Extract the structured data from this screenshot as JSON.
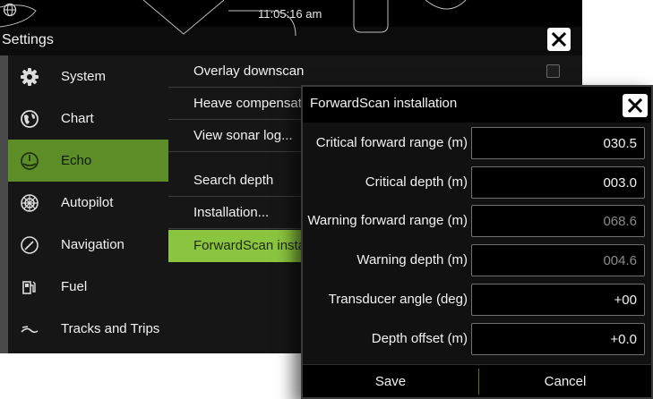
{
  "status_bar": {
    "time": "11:05:16 am"
  },
  "settings": {
    "title": "Settings",
    "sidebar": [
      {
        "label": "System",
        "icon": "gear-icon"
      },
      {
        "label": "Chart",
        "icon": "globe-icon"
      },
      {
        "label": "Echo",
        "icon": "sonar-icon",
        "active": true
      },
      {
        "label": "Autopilot",
        "icon": "helm-icon"
      },
      {
        "label": "Navigation",
        "icon": "compass-icon"
      },
      {
        "label": "Fuel",
        "icon": "fuel-pump-icon"
      },
      {
        "label": "Tracks and Trips",
        "icon": "track-icon"
      }
    ],
    "options": [
      {
        "label": "Overlay downscan",
        "checkbox": true
      },
      {
        "label": "Heave compensat"
      },
      {
        "label": "View sonar log..."
      },
      {
        "label": "Search depth"
      },
      {
        "label": "Installation..."
      },
      {
        "label": "ForwardScan insta",
        "active": true
      }
    ]
  },
  "dialog": {
    "title": "ForwardScan installation",
    "fields": [
      {
        "label": "Critical forward range (m)",
        "value": "030.5",
        "enabled": true
      },
      {
        "label": "Critical depth (m)",
        "value": "003.0",
        "enabled": true
      },
      {
        "label": "Warning forward range (m)",
        "value": "068.6",
        "enabled": false
      },
      {
        "label": "Warning depth (m)",
        "value": "004.6",
        "enabled": false
      },
      {
        "label": "Transducer angle (deg)",
        "value": "+00",
        "enabled": true
      },
      {
        "label": "Depth offset (m)",
        "value": "+0.0",
        "enabled": true
      }
    ],
    "save_label": "Save",
    "cancel_label": "Cancel"
  },
  "colors": {
    "echo_active": "#5d8d27",
    "option_active": "#8bc53f",
    "background": "#161616"
  }
}
